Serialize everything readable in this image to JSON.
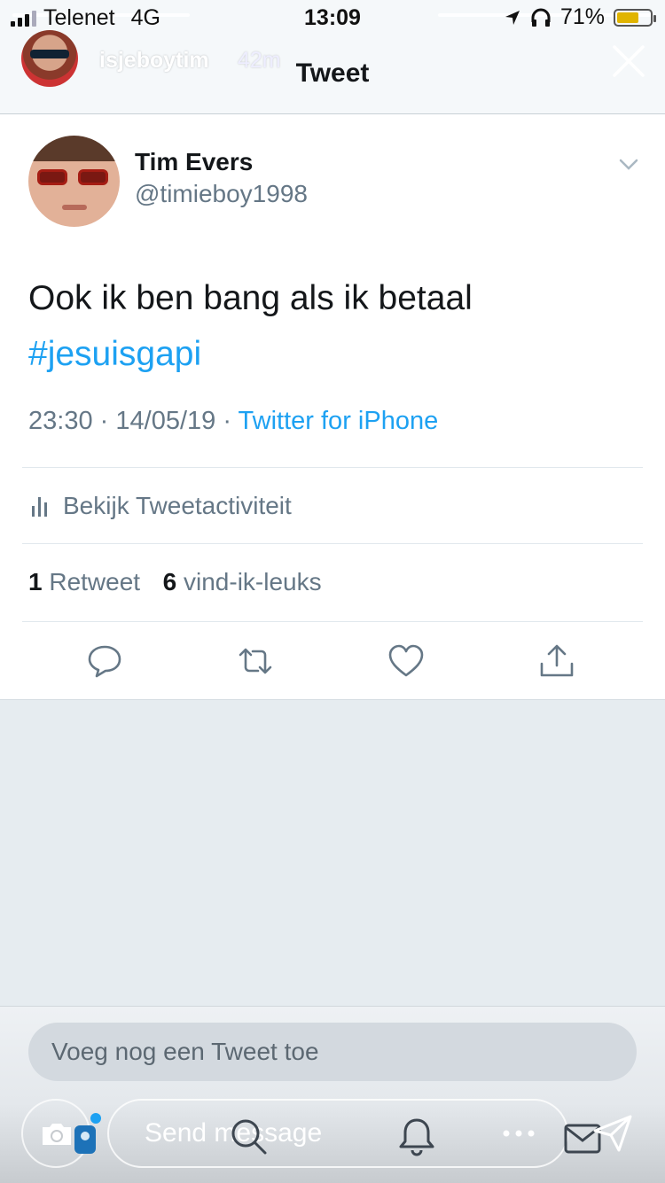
{
  "status_bar": {
    "carrier": "Telenet",
    "network": "4G",
    "time": "13:09",
    "battery_percent": "71%",
    "battery_level": 0.71
  },
  "story": {
    "username": "isjeboytim",
    "age": "42m",
    "progress_segments": 3
  },
  "header": {
    "title": "Tweet"
  },
  "tweet": {
    "author_name": "Tim Evers",
    "author_handle": "@timieboy1998",
    "text": "Ook ik ben bang als ik betaal",
    "hashtag": "#jesuisgapi",
    "time": "23:30",
    "date": "14/05/19",
    "separator": "·",
    "source": "Twitter for iPhone",
    "activity_label": "Bekijk Tweetactiviteit",
    "retweet_count": "1",
    "retweet_label": "Retweet",
    "like_count": "6",
    "like_label": "vind-ik-leuks"
  },
  "actions": [
    "reply-icon",
    "retweet-icon",
    "like-icon",
    "share-icon"
  ],
  "footer": {
    "add_tweet_placeholder": "Voeg nog een Tweet toe",
    "message_placeholder": "Send message"
  },
  "colors": {
    "twitter_blue": "#1da1f2",
    "secondary_text": "#657786",
    "background": "#e6ecf0"
  }
}
